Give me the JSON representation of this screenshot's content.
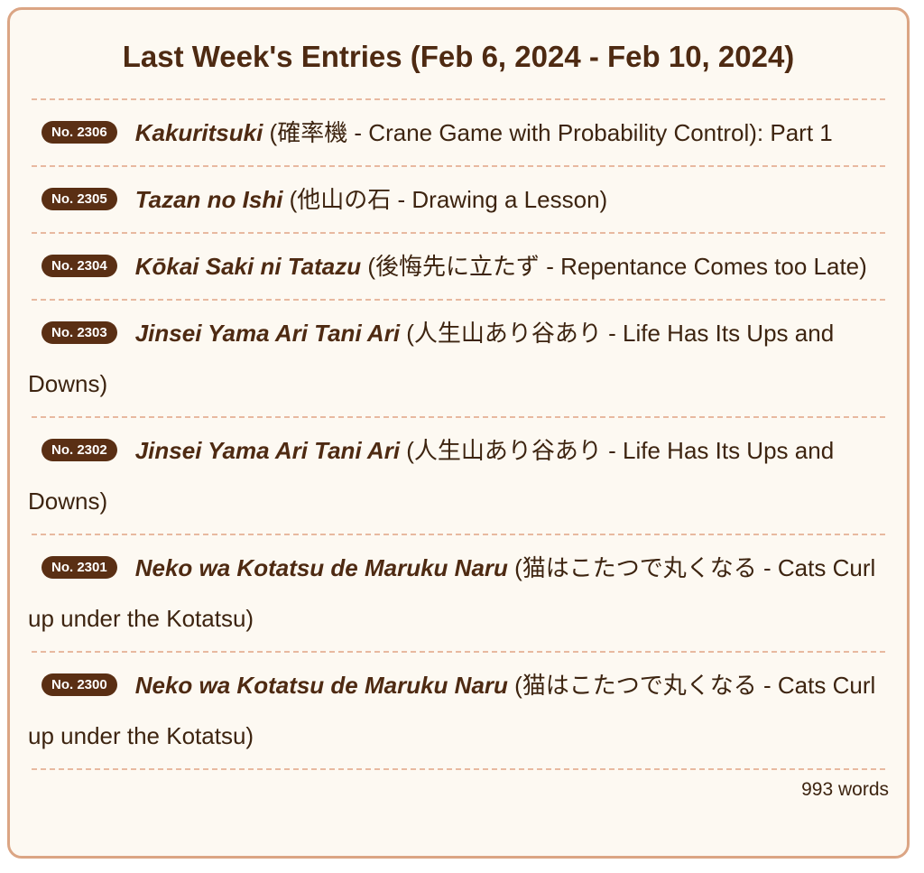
{
  "title": "Last Week's Entries (Feb 6, 2024 - Feb 10, 2024)",
  "entries": [
    {
      "number": "No. 2306",
      "romaji": "Kakuritsuki",
      "description": " (確率機 - Crane Game with Probability Control): Part 1"
    },
    {
      "number": "No. 2305",
      "romaji": "Tazan no Ishi",
      "description": " (他山の石 - Drawing a Lesson)"
    },
    {
      "number": "No. 2304",
      "romaji": "Kōkai Saki ni Tatazu",
      "description": " (後悔先に立たず - Repentance Comes too Late)"
    },
    {
      "number": "No. 2303",
      "romaji": "Jinsei Yama Ari Tani Ari",
      "description": " (人生山あり谷あり - Life Has Its Ups and Downs)"
    },
    {
      "number": "No. 2302",
      "romaji": "Jinsei Yama Ari Tani Ari",
      "description": " (人生山あり谷あり - Life Has Its Ups and Downs)"
    },
    {
      "number": "No. 2301",
      "romaji": "Neko wa Kotatsu de Maruku Naru",
      "description": " (猫はこたつで丸くなる - Cats Curl up under the Kotatsu)"
    },
    {
      "number": "No. 2300",
      "romaji": "Neko wa Kotatsu de Maruku Naru",
      "description": " (猫はこたつで丸くなる - Cats Curl up under the Kotatsu)"
    }
  ],
  "word_count": "993 words",
  "colors": {
    "border": "#dba584",
    "background": "#fdf9f2",
    "title": "#4e2a12",
    "badge": "#5a2f14",
    "separator": "#e8b9a0"
  }
}
